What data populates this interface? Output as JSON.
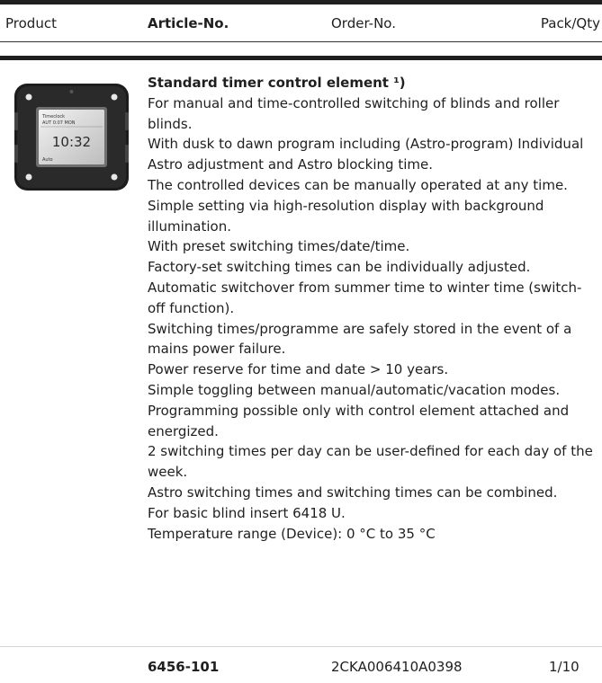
{
  "table": {
    "headers": {
      "product": "Product",
      "article": "Article-No.",
      "order": "Order-No.",
      "pack": "Pack/Qty"
    }
  },
  "item": {
    "title": "Standard timer control element ¹)",
    "image_icon": "timer-control-device-image",
    "device_screen": {
      "line1": "Timeclock",
      "line2": "AUT 0:07 MON",
      "time": "10:32",
      "footer": "Auto"
    },
    "description": [
      "For manual and time-controlled switching of blinds and roller blinds.",
      "With dusk to dawn program including (Astro-program) Individual Astro adjustment and Astro blocking time.",
      "The controlled devices can be manually operated at any time.",
      "Simple setting via high-resolution display with background illumination.",
      "With preset switching times/date/time.",
      "Factory-set switching times can be individually adjusted.",
      "Automatic switchover from summer time to winter time (switch-off function).",
      "Switching times/programme are safely stored in the event of a mains power failure.",
      "Power reserve for time and date > 10 years.",
      "Simple toggling between manual/automatic/vacation modes.",
      "Programming possible only with control element attached and energized.",
      "2 switching times per day can be user-defined for each day of the week.",
      "Astro switching times and switching times can be combined.",
      "For basic blind insert 6418 U.",
      "Temperature range (Device): 0 °C to 35 °C"
    ],
    "article_no": "6456-101",
    "order_no": "2CKA006410A0398",
    "pack_qty": "1/10"
  }
}
